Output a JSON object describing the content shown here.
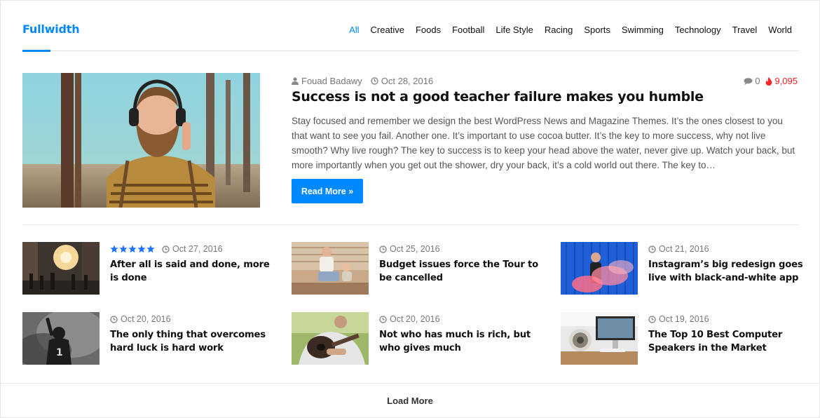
{
  "block": {
    "title": "Fullwidth",
    "accent_color": "#0088ff"
  },
  "nav": [
    {
      "label": "All",
      "active": true
    },
    {
      "label": "Creative"
    },
    {
      "label": "Foods"
    },
    {
      "label": "Football"
    },
    {
      "label": "Life Style"
    },
    {
      "label": "Racing"
    },
    {
      "label": "Sports"
    },
    {
      "label": "Swimming"
    },
    {
      "label": "Technology"
    },
    {
      "label": "Travel"
    },
    {
      "label": "World"
    }
  ],
  "featured": {
    "author": "Fouad Badawy",
    "date": "Oct 28, 2016",
    "comments": "0",
    "views": "9,095",
    "title": "Success is not a good teacher failure makes you humble",
    "excerpt": "Stay focused and remember we design the best WordPress News and Magazine Themes. It’s the ones closest to you that want to see you fail. Another one. It’s important to use cocoa butter. It’s the key to more success, why not live smooth? Why live rough? The key to success is to keep your head above the water, never give up. Watch your back, but more importantly when you get out the shower, dry your back, it’s a cold world out there. The key to…",
    "read_more": "Read More »"
  },
  "posts": [
    {
      "date": "Oct 27, 2016",
      "title": "After all is said and done, more is done",
      "rating": 5
    },
    {
      "date": "Oct 25, 2016",
      "title": "Budget issues force the Tour to be cancelled"
    },
    {
      "date": "Oct 21, 2016",
      "title": "Instagram’s big redesign goes live with black-and-white app"
    },
    {
      "date": "Oct 20, 2016",
      "title": "The only thing that overcomes hard luck is hard work"
    },
    {
      "date": "Oct 20, 2016",
      "title": "Not who has much is rich, but who gives much"
    },
    {
      "date": "Oct 19, 2016",
      "title": "The Top 10 Best Computer Speakers in the Market"
    }
  ],
  "load_more": "Load More",
  "icons": {
    "author": "user-icon",
    "date": "clock-icon",
    "comments": "comment-icon",
    "views": "flame-icon",
    "rating": "star-icon"
  }
}
